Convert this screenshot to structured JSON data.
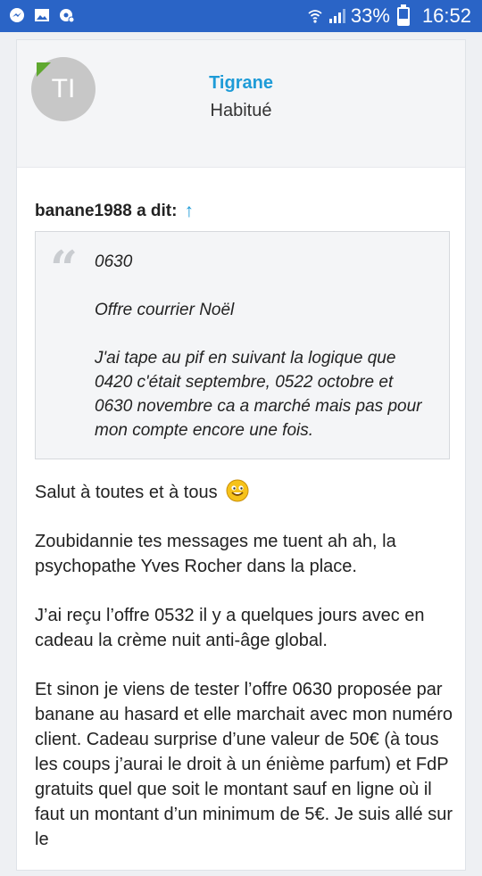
{
  "status_bar": {
    "battery_percent": "33%",
    "battery_level": 0.33,
    "time": "16:52",
    "notification_icons": [
      "messenger-icon",
      "gallery-icon",
      "settings-notification-icon"
    ]
  },
  "user": {
    "initials": "TI",
    "name": "Tigrane",
    "title": "Habitué"
  },
  "quote": {
    "author_line": "banane1988 a dit:",
    "arrow": "↑",
    "mark": "“",
    "paragraphs": [
      "0630",
      "Offre courrier Noël",
      "J'ai tape au pif en suivant la logique que 0420 c'était septembre, 0522 octobre et 0630 novembre ca a marché mais pas pour mon compte encore une fois."
    ]
  },
  "post": {
    "greeting": "Salut à toutes et à tous",
    "paragraphs": [
      "Zoubidannie tes messages me tuent ah ah, la psychopathe Yves Rocher dans la place.",
      "J’ai reçu l’offre 0532 il y a quelques jours avec en cadeau la crème nuit anti-âge global.",
      "Et sinon je viens de tester l’offre 0630 proposée par banane au hasard et elle marchait avec mon numéro client. Cadeau surprise d’une valeur de 50€ (à tous les coups j’aurai le droit à un énième parfum) et FdP gratuits quel que soit le montant sauf en ligne où il faut un montant d’un minimum de 5€. Je suis allé sur le"
    ]
  },
  "colors": {
    "status_bar": "#2a64c6",
    "username": "#1e9bd7",
    "avatar_flag": "#5fa82f"
  }
}
